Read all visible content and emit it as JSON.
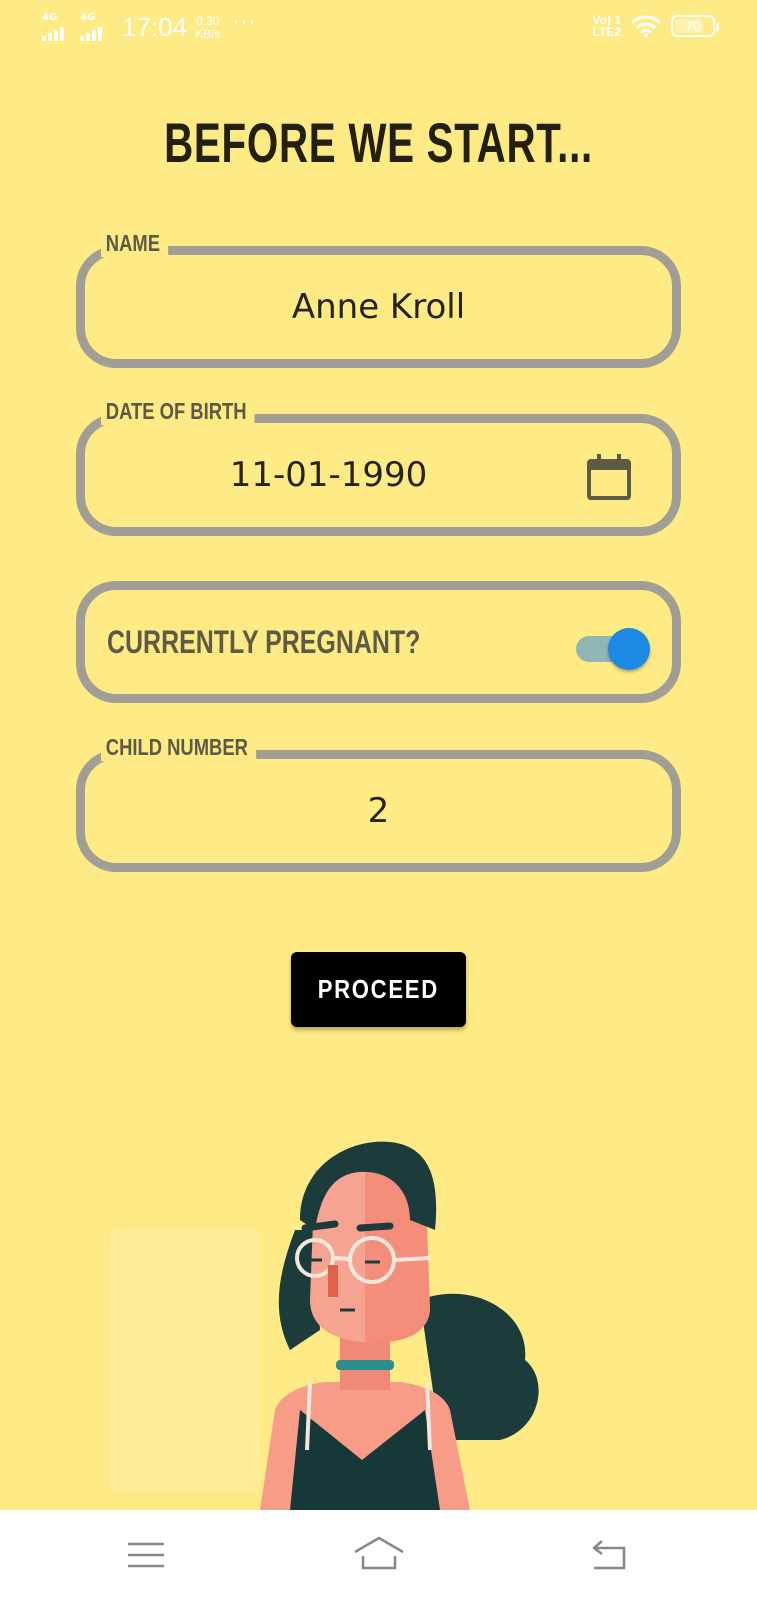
{
  "status_bar": {
    "network_1": "4G",
    "network_2": "4G",
    "time": "17:04",
    "speed_value": "0.30",
    "speed_unit": "KB/s",
    "more": "···",
    "volte_line1": "Vo) 1",
    "volte_line2": "LTE2",
    "battery": "70"
  },
  "page": {
    "title": "BEFORE WE START..."
  },
  "form": {
    "name": {
      "label": "NAME",
      "value": "Anne Kroll"
    },
    "dob": {
      "label": "DATE OF BIRTH",
      "value": "11-01-1990",
      "icon": "calendar-icon"
    },
    "pregnant": {
      "label": "CURRENTLY PREGNANT?",
      "checked": true
    },
    "child_number": {
      "label": "CHILD NUMBER",
      "value": "2"
    }
  },
  "actions": {
    "proceed_label": "PROCEED"
  },
  "nav_bar": {
    "items": [
      "menu-icon",
      "home-icon",
      "back-icon"
    ]
  },
  "colors": {
    "background": "#FEEB85",
    "field_border": "#A09E95",
    "toggle_thumb": "#1E88E5",
    "button": "#000000"
  }
}
